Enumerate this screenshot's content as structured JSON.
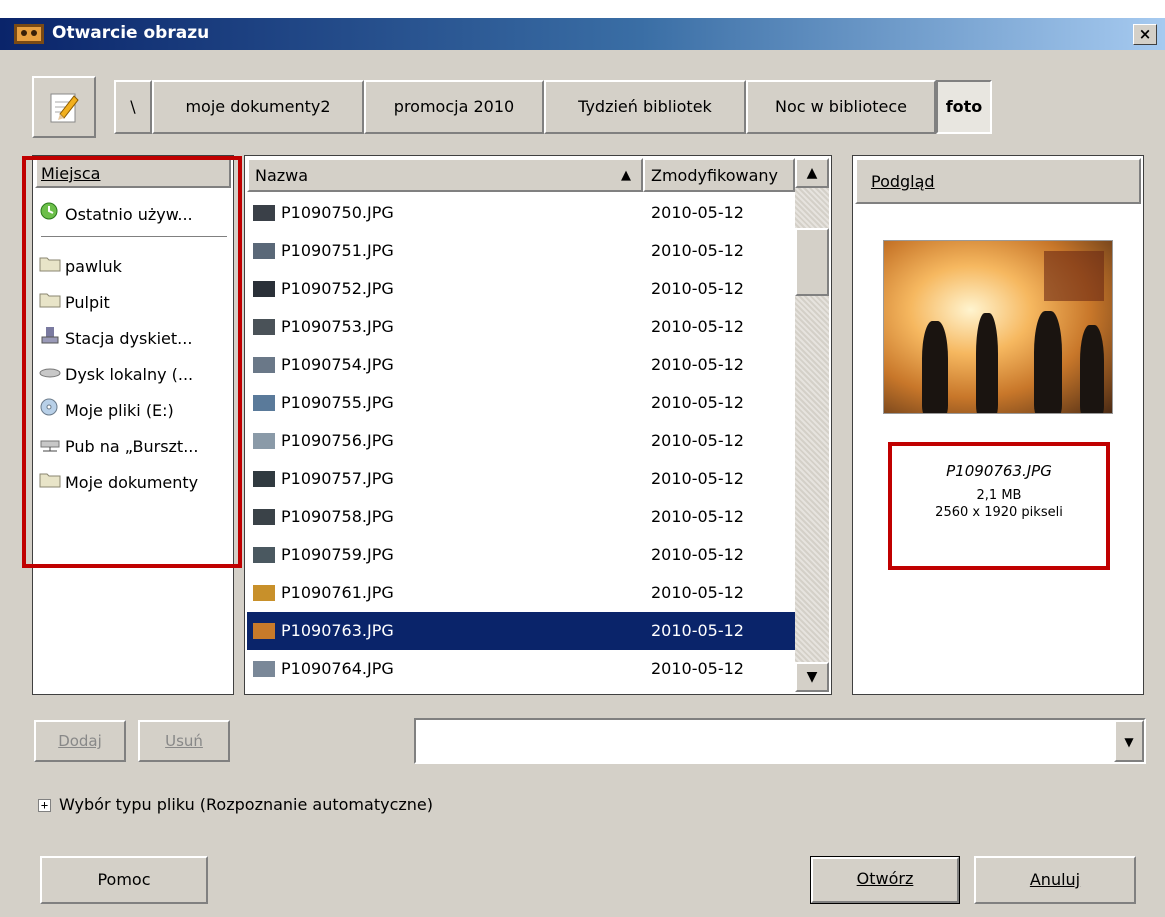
{
  "window": {
    "title": "Otwarcie obrazu",
    "close_glyph": "×"
  },
  "path_bar": {
    "edit_icon": "pencil-icon",
    "crumbs": [
      "\\",
      "moje dokumenty2",
      "promocja 2010",
      "Tydzień bibliotek",
      "Noc w bibliotece",
      "foto"
    ],
    "active_index": 5
  },
  "places": {
    "header": "Miejsca",
    "items": [
      {
        "label": "Ostatnio używ...",
        "icon": "recent-icon"
      },
      {
        "label": "pawluk",
        "icon": "folder-icon"
      },
      {
        "label": "Pulpit",
        "icon": "folder-icon"
      },
      {
        "label": "Stacja dyskiet...",
        "icon": "floppy-icon"
      },
      {
        "label": "Dysk lokalny (...",
        "icon": "harddisk-icon"
      },
      {
        "label": "Moje pliki (E:)",
        "icon": "cdrom-icon"
      },
      {
        "label": "Pub na „Burszt...",
        "icon": "network-drive-icon"
      },
      {
        "label": "Moje dokumenty",
        "icon": "folder-icon"
      }
    ]
  },
  "files": {
    "col_name": "Nazwa",
    "col_modified": "Zmodyfikowany",
    "sort_glyph": "▲",
    "rows": [
      {
        "name": "P1090750.JPG",
        "date": "2010-05-12"
      },
      {
        "name": "P1090751.JPG",
        "date": "2010-05-12"
      },
      {
        "name": "P1090752.JPG",
        "date": "2010-05-12"
      },
      {
        "name": "P1090753.JPG",
        "date": "2010-05-12"
      },
      {
        "name": "P1090754.JPG",
        "date": "2010-05-12"
      },
      {
        "name": "P1090755.JPG",
        "date": "2010-05-12"
      },
      {
        "name": "P1090756.JPG",
        "date": "2010-05-12"
      },
      {
        "name": "P1090757.JPG",
        "date": "2010-05-12"
      },
      {
        "name": "P1090758.JPG",
        "date": "2010-05-12"
      },
      {
        "name": "P1090759.JPG",
        "date": "2010-05-12"
      },
      {
        "name": "P1090761.JPG",
        "date": "2010-05-12"
      },
      {
        "name": "P1090763.JPG",
        "date": "2010-05-12"
      },
      {
        "name": "P1090764.JPG",
        "date": "2010-05-12"
      }
    ],
    "selected_index": 11
  },
  "preview": {
    "header": "Podgląd",
    "filename": "P1090763.JPG",
    "size": "2,1 MB",
    "dimensions": "2560 x 1920 pikseli"
  },
  "actions": {
    "add_label": "Dodaj",
    "remove_label": "Usuń",
    "filename_value": "",
    "file_type_expander": "Wybór typu pliku (Rozpoznanie automatyczne)",
    "expander_glyph": "+",
    "help_label": "Pomoc",
    "open_label": "Otwórz",
    "cancel_label": "Anuluj"
  },
  "colors": {
    "title_gradient_start": "#0a246a",
    "selection": "#0a246a",
    "highlight_box": "#c00000",
    "dialog_bg": "#d4d0c8"
  }
}
